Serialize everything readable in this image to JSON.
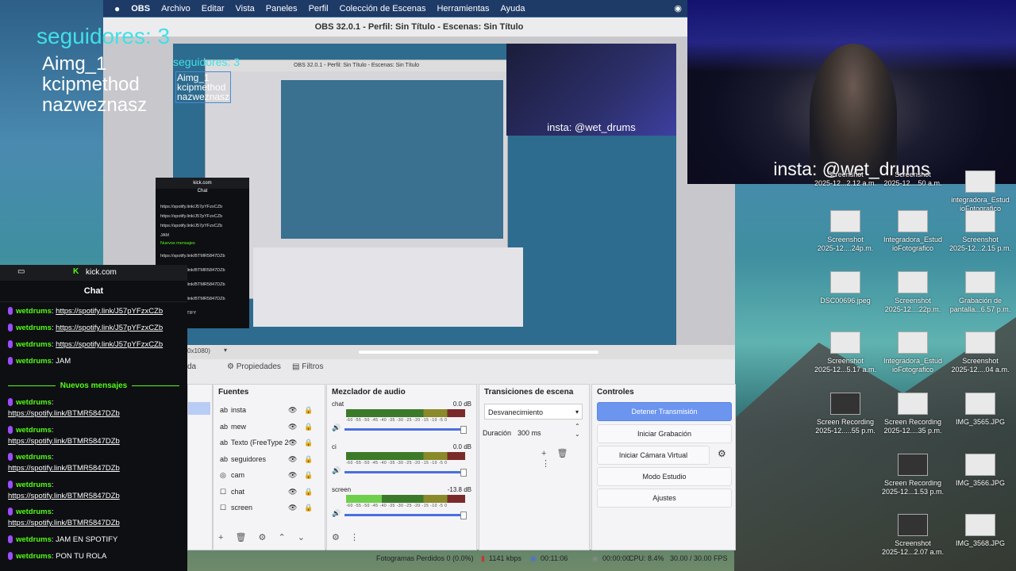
{
  "menubar": {
    "apple": "",
    "app": "OBS",
    "items": [
      "Archivo",
      "Editar",
      "Vista",
      "Paneles",
      "Perfil",
      "Colección de Escenas",
      "Herramientas",
      "Ayuda"
    ]
  },
  "obs": {
    "title": "OBS 32.0.1 - Perfil: Sin Título - Escenas: Sin Título",
    "preview_label": "insta: @wet_drums",
    "res_label": "0x1080)",
    "tabs": {
      "scenes": "da",
      "properties": "Propiedades",
      "filters": "Filtros"
    },
    "sources": {
      "header": "Fuentes",
      "items": [
        {
          "icon": "ab",
          "name": "insta"
        },
        {
          "icon": "ab",
          "name": "mew"
        },
        {
          "icon": "ab",
          "name": "Texto (FreeType 2"
        },
        {
          "icon": "ab",
          "name": "seguidores"
        },
        {
          "icon": "◎",
          "name": "cam"
        },
        {
          "icon": "☐",
          "name": "chat"
        },
        {
          "icon": "☐",
          "name": "screen"
        }
      ]
    },
    "mixer": {
      "header": "Mezclador de audio",
      "channels": [
        {
          "name": "chat",
          "db": "0.0 dB",
          "level": 0.0
        },
        {
          "name": "ci",
          "db": "0.0 dB",
          "level": 0.0
        },
        {
          "name": "screen",
          "db": "-13.8 dB",
          "level": 0.3
        }
      ],
      "ticks": "-60 -55 -50 -45 -40 -35 -30 -25 -20 -15 -10 -5 0"
    },
    "transitions": {
      "header": "Transiciones de escena",
      "selected": "Desvanecimiento",
      "duration_label": "Duración",
      "duration_value": "300 ms"
    },
    "controls": {
      "header": "Controles",
      "buttons": [
        "Detener Transmisión",
        "Iniciar Grabación",
        "Iniciar Cámara Virtual",
        "Modo Estudio",
        "Ajustes"
      ]
    },
    "status": {
      "dropped": "Fotogramas Perdidos 0 (0.0%)",
      "bitrate": "1141 kbps",
      "stream_time": "00:11:06",
      "rec_time": "00:00:00",
      "cpu": "CPU: 8.4%",
      "fps": "30.00 / 30.00 FPS"
    }
  },
  "overlay": {
    "followers": "seguidores: 3",
    "names": [
      "Aimg_1",
      "kcipmethod",
      "nazweznasz"
    ]
  },
  "webcam": {
    "label": "insta: @wet_drums"
  },
  "chat": {
    "tab_label": "kick.com",
    "header": "Chat",
    "messages_top": [
      {
        "user": "wetdrums",
        "text": "https://spotify.link/J57pYFzxCZb"
      },
      {
        "user": "wetdrums",
        "text": "https://spotify.link/J57pYFzxCZb"
      },
      {
        "user": "wetdrums",
        "text": "https://spotify.link/J57pYFzxCZb"
      },
      {
        "user": "wetdrums",
        "text": "JAM"
      }
    ],
    "new_messages": "Nuevos mensajes",
    "messages_bottom": [
      {
        "user": "wetdrums",
        "text": "https://spotify.link/BTMR5847DZb"
      },
      {
        "user": "wetdrums",
        "text": "https://spotify.link/BTMR5847DZb"
      },
      {
        "user": "wetdrums",
        "text": "https://spotify.link/BTMR5847DZb"
      },
      {
        "user": "wetdrums",
        "text": "https://spotify.link/BTMR5847DZb"
      },
      {
        "user": "wetdrums",
        "text": "https://spotify.link/BTMR5847DZb"
      },
      {
        "user": "wetdrums",
        "text": "JAM EN SPOTIFY"
      },
      {
        "user": "wetdrums",
        "text": "PON TU ROLA"
      }
    ]
  },
  "desktop_icons": [
    {
      "label": "Screenshot\n2025-12...2.12 a.m."
    },
    {
      "label": "Screenshot\n2025-12....50 a.m."
    },
    {
      "label": "integradora_Estud\nioFotografico"
    },
    {
      "label": "Screenshot\n2025-12....24p.m."
    },
    {
      "label": "Integradora_Estud\nioFotografico"
    },
    {
      "label": "Screenshot\n2025-12...2.15 p.m."
    },
    {
      "label": "DSC00696.jpeg"
    },
    {
      "label": "Screenshot\n2025-12....22p.m."
    },
    {
      "label": "Grabación de\npantalla...6.57 p.m."
    },
    {
      "label": "Screenshot\n2025-12...5.17 a.m."
    },
    {
      "label": "Integradora_Estud\nioFotografico"
    },
    {
      "label": "Screenshot\n2025-12....04 a.m."
    },
    {
      "label": "Screen Recording\n2025-12.....55 p.m."
    },
    {
      "label": "Screen Recording\n2025-12....35 p.m."
    },
    {
      "label": "IMG_3565.JPG"
    },
    {
      "label": "Screen Recording\n2025-12...1.53 p.m."
    },
    {
      "label": "IMG_3566.JPG"
    },
    {
      "label": "Screenshot\n2025-12...2.07 a.m."
    },
    {
      "label": "IMG_3568.JPG"
    }
  ]
}
